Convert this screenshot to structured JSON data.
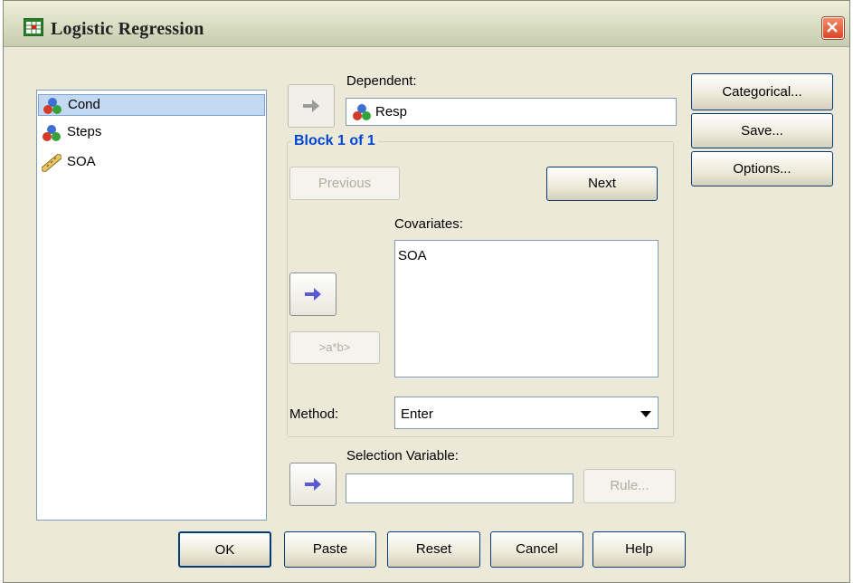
{
  "window": {
    "title": "Logistic Regression"
  },
  "variables": [
    {
      "label": "Cond",
      "icon": "nominal-variable-icon",
      "selected": true
    },
    {
      "label": "Steps",
      "icon": "nominal-variable-icon",
      "selected": false
    },
    {
      "label": "SOA",
      "icon": "scale-variable-icon",
      "selected": false
    }
  ],
  "dependent": {
    "label": "Dependent:",
    "value": "Resp"
  },
  "block": {
    "title": "Block 1 of 1",
    "previous": "Previous",
    "next": "Next"
  },
  "covariates": {
    "label": "Covariates:",
    "items": [
      "SOA"
    ],
    "interaction": ">a*b>"
  },
  "method": {
    "label": "Method:",
    "value": "Enter"
  },
  "selection": {
    "label": "Selection Variable:",
    "value": "",
    "rule": "Rule..."
  },
  "side_buttons": {
    "categorical": "Categorical...",
    "save": "Save...",
    "options": "Options..."
  },
  "bottom_buttons": {
    "ok": "OK",
    "paste": "Paste",
    "reset": "Reset",
    "cancel": "Cancel",
    "help": "Help"
  },
  "colors": {
    "accent": "#0046d5",
    "selection": "#c3d8f2",
    "close": "#d9482a"
  }
}
